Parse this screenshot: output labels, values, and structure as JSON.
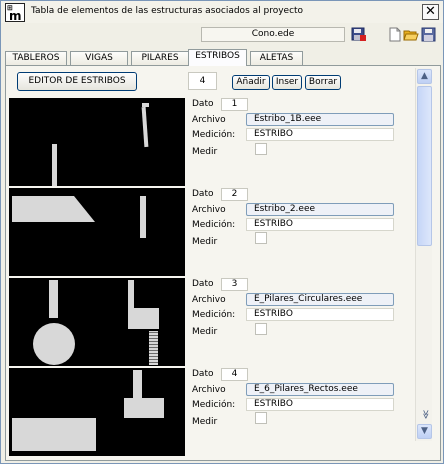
{
  "title": "Tabla de elementos de las estructuras asociados al proyecto",
  "logo_text": "m",
  "file_name": "Cono.ede",
  "icons": {
    "close": "close-icon",
    "save_red": "save-red-icon",
    "new_file": "new-file-icon",
    "open_folder": "open-folder-icon",
    "save": "save-icon"
  },
  "tabs": [
    {
      "label": "TABLEROS",
      "active": false
    },
    {
      "label": "VIGAS",
      "active": false
    },
    {
      "label": "PILARES",
      "active": false
    },
    {
      "label": "ESTRIBOS",
      "active": true
    },
    {
      "label": "ALETAS",
      "active": false
    }
  ],
  "toolbar": {
    "editor_label": "EDITOR DE ESTRIBOS",
    "count": "4",
    "add_label": "Añadir",
    "insert_label": "Inser",
    "delete_label": "Borrar"
  },
  "field_labels": {
    "dato": "Dato",
    "archivo": "Archivo",
    "medicion": "Medición:",
    "medir": "Medir"
  },
  "entries": [
    {
      "dato": "1",
      "archivo": "Estribo_1B.eee",
      "medicion": "ESTRIBO",
      "medir": false
    },
    {
      "dato": "2",
      "archivo": "Estribo_2.eee",
      "medicion": "ESTRIBO",
      "medir": false
    },
    {
      "dato": "3",
      "archivo": "E_Pilares_Circulares.eee",
      "medicion": "ESTRIBO",
      "medir": false
    },
    {
      "dato": "4",
      "archivo": "E_6_Pilares_Rectos.eee",
      "medicion": "ESTRIBO",
      "medir": false
    }
  ],
  "scrollbar": {
    "up": "▲",
    "down": "▼",
    "double_down": "≫"
  },
  "colors": {
    "accent_border": "#003c74",
    "thumb_bg": "#000000",
    "shape": "#d8d8d8"
  }
}
